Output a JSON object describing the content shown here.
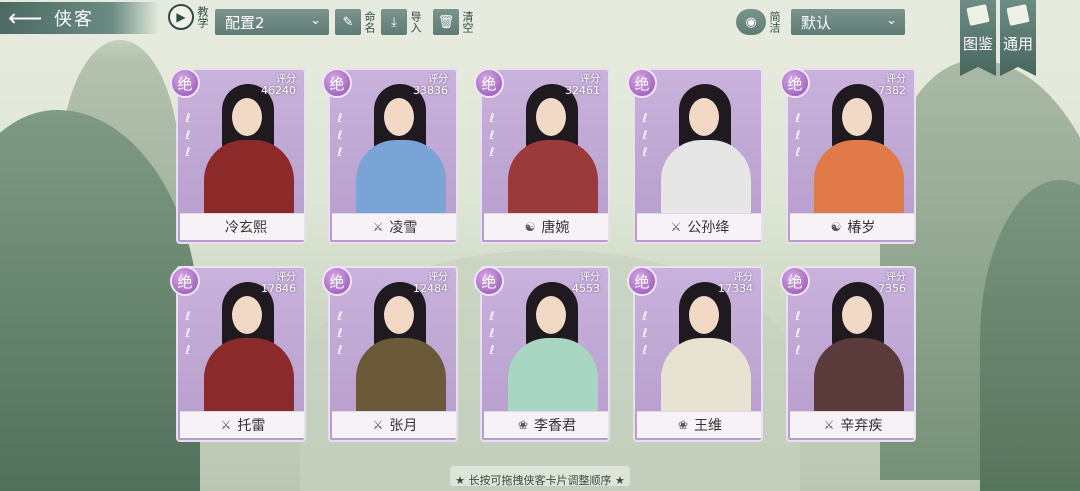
{
  "header": {
    "title": "侠客",
    "teach_label": "教学",
    "config_value": "配置2",
    "rename_label": "命名",
    "import_label": "导入",
    "clear_label": "清空",
    "filter_label": "简洁",
    "sort_value": "默认",
    "codex_label": "图鉴",
    "general_label": "通用"
  },
  "cards": [
    {
      "badge": "绝",
      "score_label": "评分",
      "score": "46240",
      "name": "冷玄熙",
      "icon": "",
      "color": "#8c2a2a"
    },
    {
      "badge": "绝",
      "score_label": "评分",
      "score": "33836",
      "name": "凌雪",
      "icon": "sword-icon",
      "color": "#7aa4d6"
    },
    {
      "badge": "绝",
      "score_label": "评分",
      "score": "32461",
      "name": "唐婉",
      "icon": "yin-yang-icon",
      "color": "#9b3a3a"
    },
    {
      "badge": "绝",
      "score_label": "",
      "score": "",
      "name": "公孙绛",
      "icon": "sword-icon",
      "color": "#e6e6e6"
    },
    {
      "badge": "绝",
      "score_label": "评分",
      "score": "7382",
      "name": "椿岁",
      "icon": "yin-yang-icon",
      "color": "#e07a4a"
    },
    {
      "badge": "绝",
      "score_label": "评分",
      "score": "17846",
      "name": "托雷",
      "icon": "sword-icon",
      "color": "#8a2a2a"
    },
    {
      "badge": "绝",
      "score_label": "评分",
      "score": "12484",
      "name": "张月",
      "icon": "sword-icon",
      "color": "#6b5a3a"
    },
    {
      "badge": "绝",
      "score_label": "评分",
      "score": "4553",
      "name": "李香君",
      "icon": "lotus-icon",
      "color": "#a9d6c2"
    },
    {
      "badge": "绝",
      "score_label": "评分",
      "score": "17334",
      "name": "王维",
      "icon": "lotus-icon",
      "color": "#e8e2d2"
    },
    {
      "badge": "绝",
      "score_label": "评分",
      "score": "7356",
      "name": "辛弃疾",
      "icon": "sword-icon",
      "color": "#5a3a3a"
    }
  ],
  "footer": {
    "hint": "★ 长按可拖拽侠客卡片调整顺序 ★"
  }
}
